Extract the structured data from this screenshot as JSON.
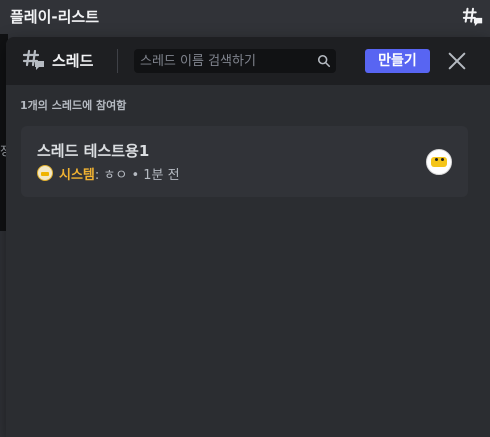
{
  "channel": {
    "title": "플레이-리스트"
  },
  "left_strip": {
    "text": "정"
  },
  "threads_panel": {
    "title": "스레드",
    "search": {
      "placeholder": "스레드 이름 검색하기",
      "value": ""
    },
    "create_label": "만들기",
    "section_label": "1개의 스레드에 참여함",
    "threads": [
      {
        "name": "스레드 테스트용1",
        "last_message": {
          "author": "시스템",
          "separator": ": ",
          "text": "ㅎㅇ",
          "dot": " • ",
          "time": "1분 전"
        }
      }
    ]
  },
  "icons": {
    "top": "threads-icon",
    "header": "threads-icon",
    "search": "search-icon",
    "close": "close-icon",
    "avatar": "bot-avatar"
  },
  "colors": {
    "accent": "#5865f2",
    "author": "#f0b232",
    "panel_bg": "#2b2d31",
    "header_bg": "#1e1f22",
    "card_bg": "#313338"
  }
}
